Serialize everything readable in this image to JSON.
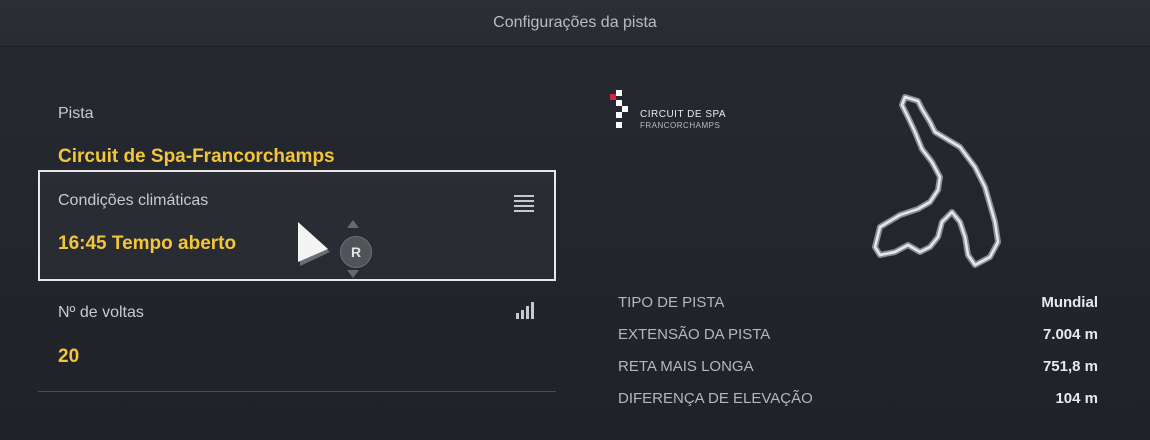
{
  "header": {
    "title": "Configurações da pista"
  },
  "settings": {
    "track": {
      "label": "Pista",
      "value": "Circuit de Spa-Francorchamps"
    },
    "weather": {
      "label": "Condições climáticas",
      "value": "16:45 Tempo aberto",
      "icon": "menu-list-icon"
    },
    "laps": {
      "label": "Nº de voltas",
      "value": "20",
      "icon": "signal-bars-icon"
    }
  },
  "controller_hint": {
    "button": "R"
  },
  "logo": {
    "line1": "CIRCUIT DE SPA",
    "line2": "FRANCORCHAMPS"
  },
  "track_info": [
    {
      "key": "TIPO DE PISTA",
      "value": "Mundial"
    },
    {
      "key": "EXTENSÃO DA PISTA",
      "value": "7.004 m"
    },
    {
      "key": "RETA MAIS LONGA",
      "value": "751,8 m"
    },
    {
      "key": "DIFERENÇA DE ELEVAÇÃO",
      "value": "104 m"
    }
  ],
  "colors": {
    "accent_yellow": "#f2c53a",
    "background": "#23262d",
    "logo_red": "#d7263d"
  }
}
